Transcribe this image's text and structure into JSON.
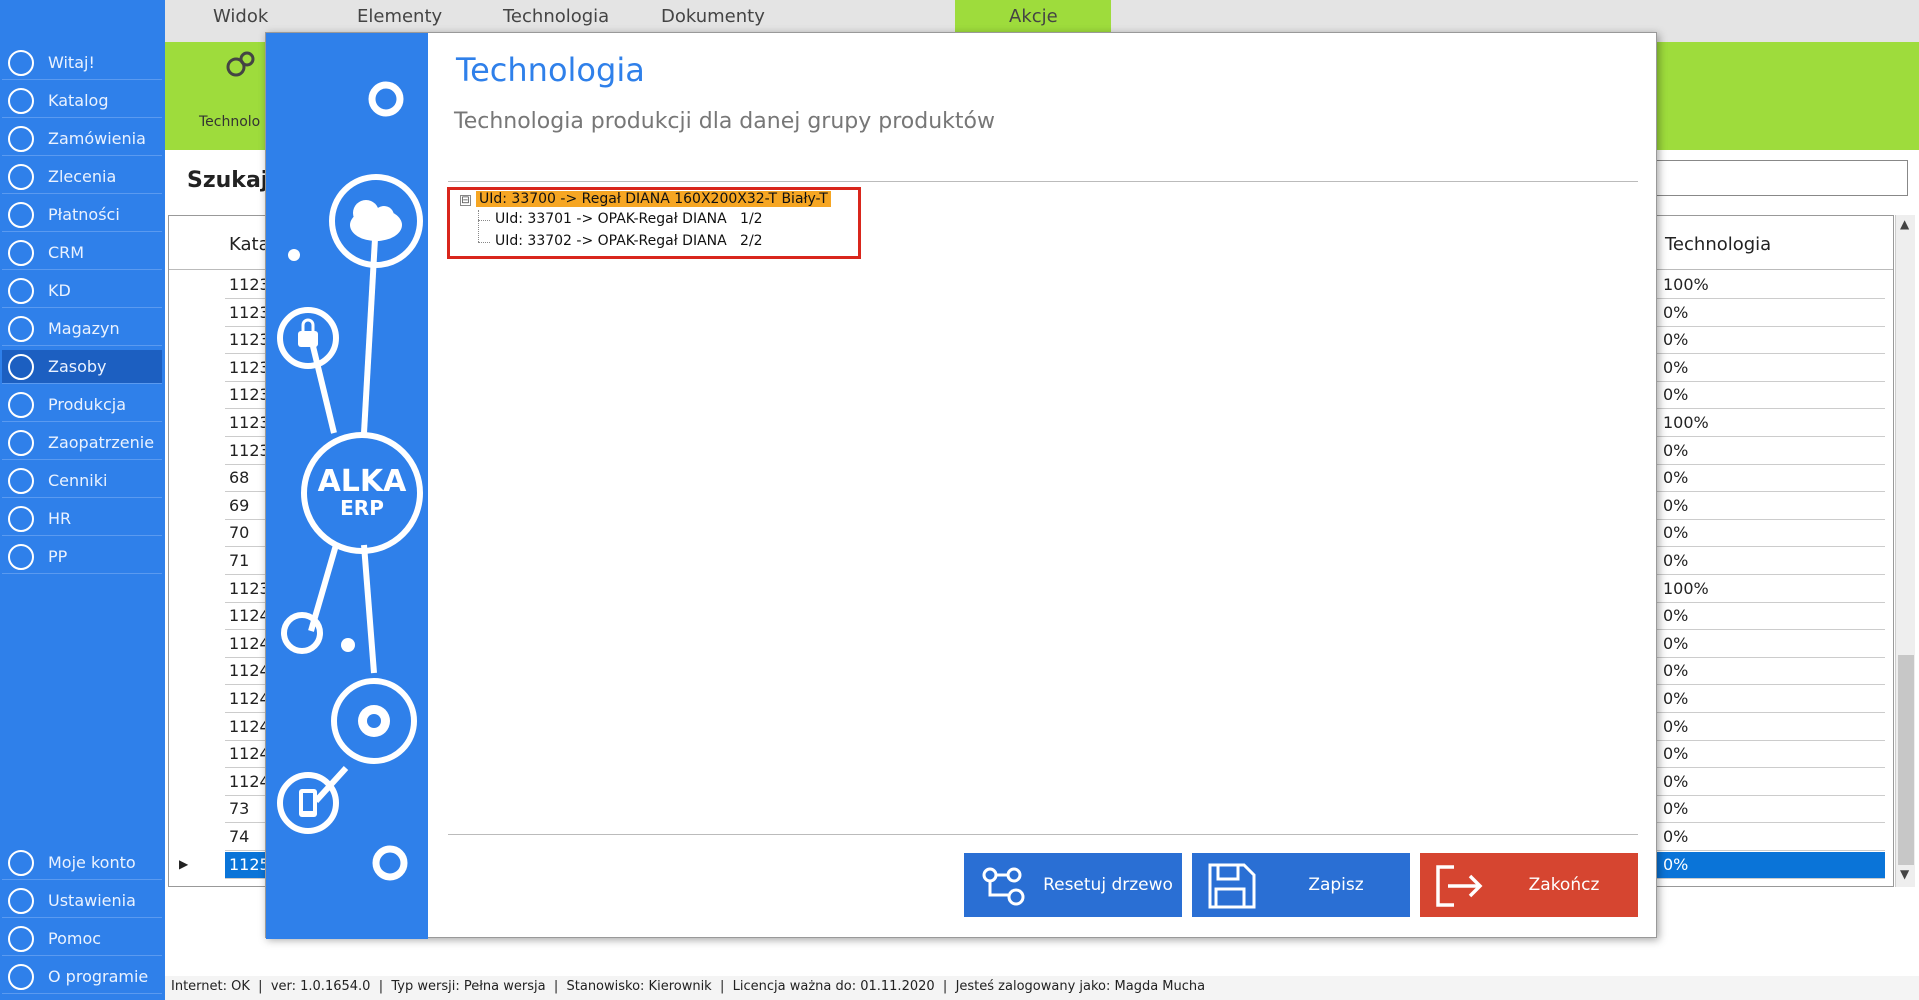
{
  "top_tabs": [
    "Widok",
    "Elementy",
    "Technologia",
    "Dokumenty",
    "Akcje"
  ],
  "ribbon_partial_label": "Technolo",
  "sidebar": {
    "items": [
      {
        "label": "Witaj!",
        "icon": "home-icon"
      },
      {
        "label": "Katalog",
        "icon": "book-icon"
      },
      {
        "label": "Zamówienia",
        "icon": "cart-icon"
      },
      {
        "label": "Zlecenia",
        "icon": "list-icon"
      },
      {
        "label": "Płatności",
        "icon": "dollar-icon"
      },
      {
        "label": "CRM",
        "icon": "crm-icon"
      },
      {
        "label": "KD",
        "icon": "person-icon"
      },
      {
        "label": "Magazyn",
        "icon": "warehouse-icon"
      },
      {
        "label": "Zasoby",
        "icon": "resources-icon",
        "active": true
      },
      {
        "label": "Produkcja",
        "icon": "production-icon"
      },
      {
        "label": "Zaopatrzenie",
        "icon": "truck-icon"
      },
      {
        "label": "Cenniki",
        "icon": "tag-icon"
      },
      {
        "label": "HR",
        "icon": "hr-icon"
      },
      {
        "label": "PP",
        "icon": "pp-icon"
      }
    ],
    "bottom_items": [
      {
        "label": "Moje konto",
        "icon": "account-icon"
      },
      {
        "label": "Ustawienia",
        "icon": "settings-icon"
      },
      {
        "label": "Pomoc",
        "icon": "help-icon"
      },
      {
        "label": "O programie",
        "icon": "info-icon"
      }
    ]
  },
  "search": {
    "label": "Szukaj:",
    "value": ""
  },
  "grid": {
    "left_header": "Kata",
    "right_header": "Technologia",
    "left_values": [
      "1123",
      "1123",
      "1123",
      "1123",
      "1123",
      "1123",
      "1123",
      "68",
      "69",
      "70",
      "71",
      "1123",
      "1124",
      "1124",
      "1124",
      "1124",
      "1124",
      "1124",
      "1124",
      "73",
      "74",
      "1125"
    ],
    "right_values": [
      "100%",
      "0%",
      "0%",
      "0%",
      "0%",
      "100%",
      "0%",
      "0%",
      "0%",
      "0%",
      "0%",
      "100%",
      "0%",
      "0%",
      "0%",
      "0%",
      "0%",
      "0%",
      "0%",
      "0%",
      "0%",
      "0%"
    ],
    "selected_row_index": 21
  },
  "status": {
    "internet": "Internet: OK",
    "version": "ver: 1.0.1654.0",
    "type": "Typ wersji: Pełna wersja",
    "station": "Stanowisko: Kierownik",
    "license": "Licencja ważna do: 01.11.2020",
    "user": "Jesteś zalogowany jako: Magda Mucha"
  },
  "modal": {
    "title": "Technologia",
    "subtitle": "Technologia produkcji dla danej grupy produktów",
    "logo_text_1": "ALKA",
    "logo_text_2": "ERP",
    "tree": {
      "root": "UId: 33700 -> Regał DIANA 160X200X32-T Biały-T",
      "children": [
        "UId: 33701 -> OPAK-Regał DIANA   1/2",
        "UId: 33702 -> OPAK-Regał DIANA   2/2"
      ],
      "expander": "⊟"
    },
    "buttons": {
      "reset": "Resetuj drzewo",
      "save": "Zapisz",
      "close": "Zakończ"
    }
  },
  "colors": {
    "accent": "#2f80ea",
    "ribbon": "#9edc3c",
    "close_button": "#d64530",
    "highlight": "#f6a623",
    "selection_box": "#d9261c"
  }
}
